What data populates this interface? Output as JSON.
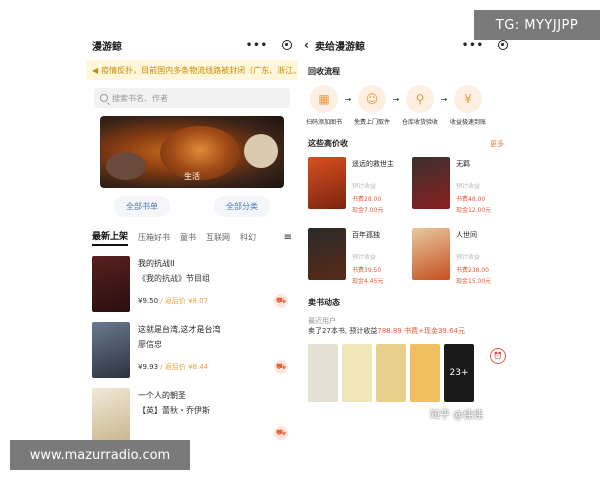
{
  "left": {
    "title": "漫游鲸",
    "more_dots": "•••",
    "notice": "疫情反扑，目前国内多条物流线路被封闭（广东、浙江、山",
    "search_placeholder": "搜索书名、作者",
    "banner_caption": "生活",
    "categories": [
      "全部书单",
      "全部分类"
    ],
    "tabs": [
      "最新上架",
      "压箱好书",
      "童书",
      "互联网",
      "科幻"
    ],
    "books": [
      {
        "title": "我的抗战II",
        "subtitle": "《我的抗战》节目组",
        "price": "¥9.50",
        "rebate": "/ 返后价 ¥8.07"
      },
      {
        "title": "这就是台湾,这才是台湾",
        "subtitle": "廖信忠",
        "price": "¥9.93",
        "rebate": "/ 返后价 ¥8.44"
      },
      {
        "title": "一个人的朝圣",
        "subtitle": "【英】蕾秋・乔伊斯",
        "price": "",
        "rebate": ""
      }
    ]
  },
  "right": {
    "title": "卖给漫游鲸",
    "more_dots": "•••",
    "flow_title": "回收流程",
    "steps": [
      "扫码添加图书",
      "免费上门取件",
      "仓库收货验收",
      "收益极速到账"
    ],
    "high_title": "这些高价收",
    "more_link": "更多",
    "grid": [
      {
        "name": "遥远的救世主",
        "est": "预计收益",
        "line1": "书费28.00",
        "line2": "现金7.00元"
      },
      {
        "name": "无羁",
        "est": "预计收益",
        "line1": "书费48.00",
        "line2": "现金12.00元"
      },
      {
        "name": "百年孤独",
        "est": "预计收益",
        "line1": "书费39.50",
        "line2": "现金4.45元"
      },
      {
        "name": "人世间",
        "est": "预计收益",
        "line1": "书费238.00",
        "line2": "现金15.00元"
      }
    ],
    "feed_title": "卖书动态",
    "feed_user": "最近用户",
    "feed_text_prefix": "卖了27本书, 预计收益",
    "feed_amount": "788.89 书费+现金39.64元",
    "strip_more": "23+"
  },
  "watermarks": {
    "tg": "TG: MYYJJPP",
    "url": "www.mazurradio.com",
    "zhihu": "知乎 @佳佳"
  }
}
